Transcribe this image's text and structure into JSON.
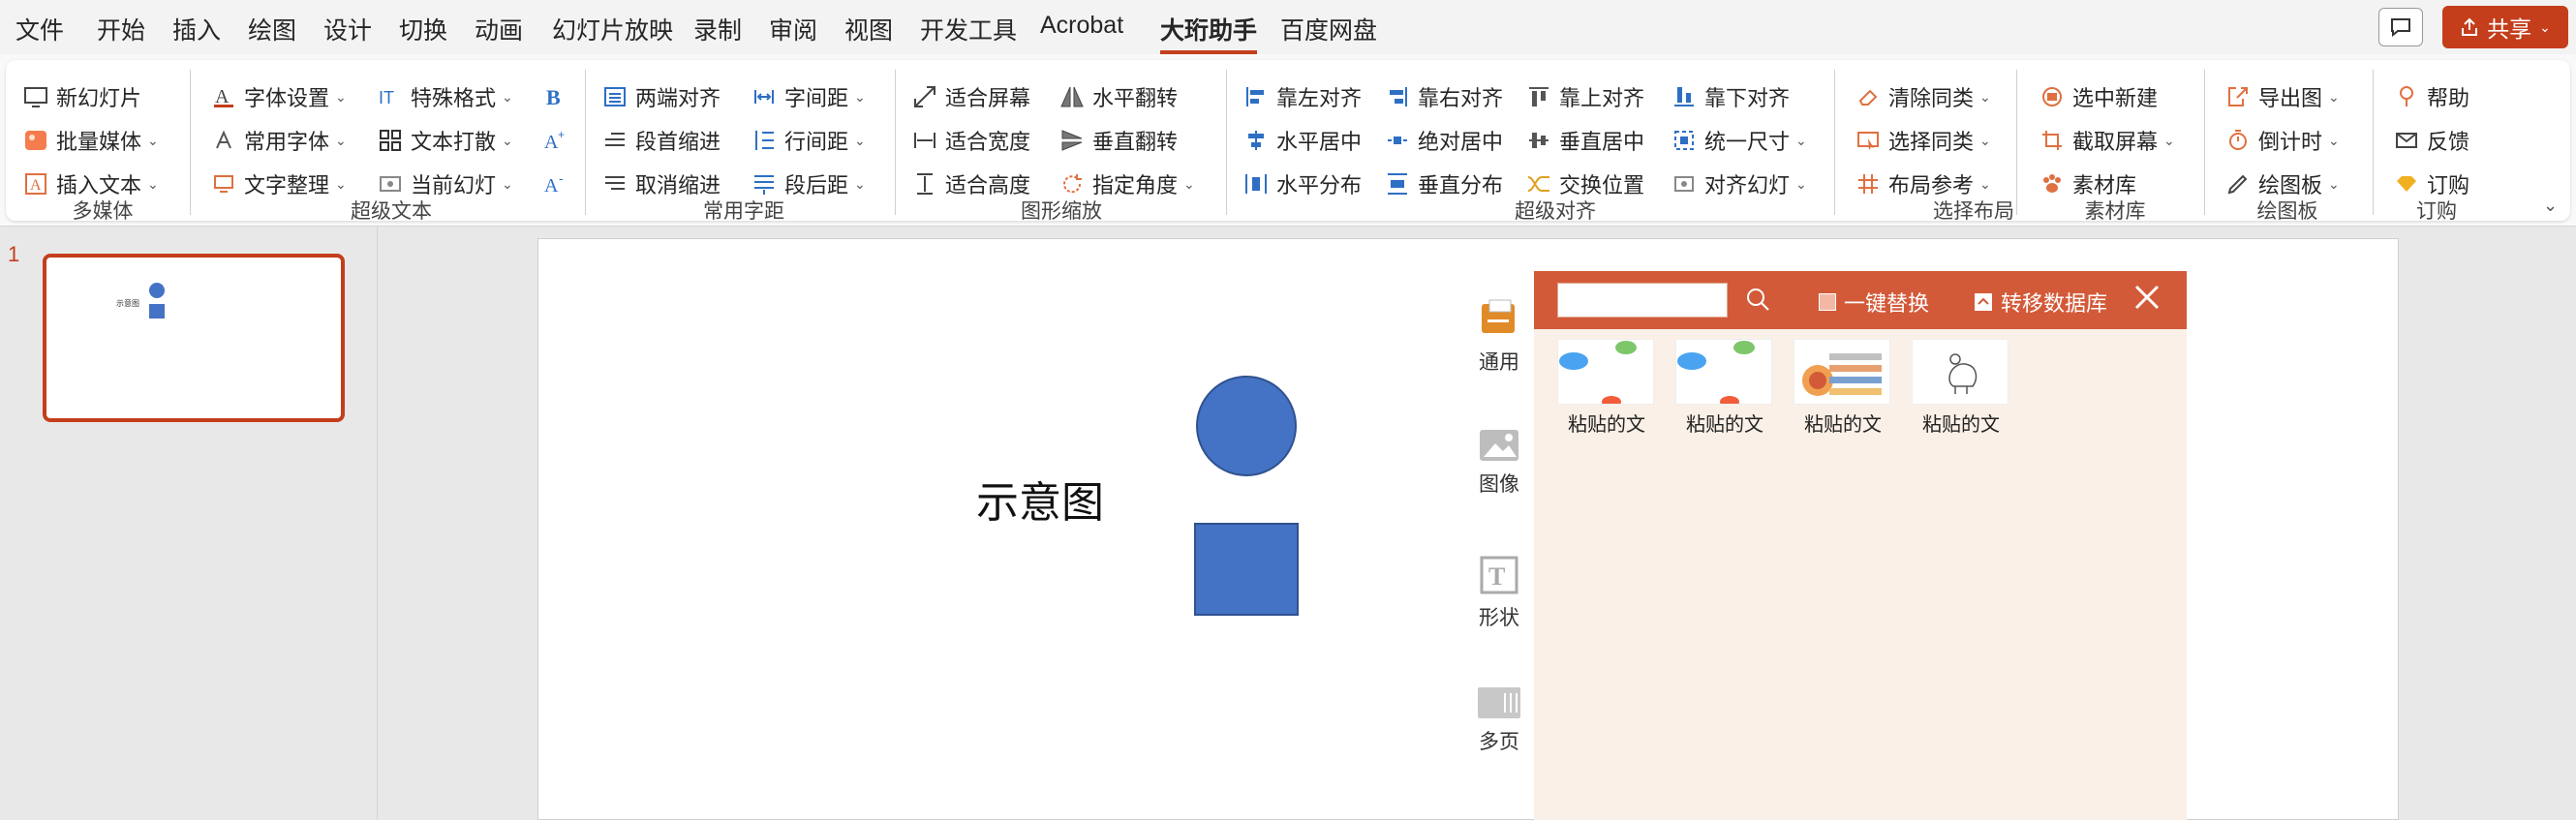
{
  "menu": {
    "tabs": [
      "文件",
      "开始",
      "插入",
      "绘图",
      "设计",
      "切换",
      "动画",
      "幻灯片放映",
      "录制",
      "审阅",
      "视图",
      "开发工具",
      "Acrobat",
      "大珩助手",
      "百度网盘"
    ],
    "active_tab": "大珩助手",
    "share_label": "共享"
  },
  "ribbon": {
    "groups": {
      "multimedia": "多媒体",
      "super_text": "超级文本",
      "spacing": "常用字距",
      "shape_scale": "图形缩放",
      "super_align": "超级对齐",
      "select_layout": "选择布局",
      "material": "素材库",
      "drawing": "绘图板",
      "subscribe": "订购"
    },
    "buttons": {
      "new_slide": "新幻灯片",
      "batch_media": "批量媒体",
      "insert_text": "插入文本",
      "font_settings": "字体设置",
      "common_fonts": "常用字体",
      "text_tidy": "文字整理",
      "special_format": "特殊格式",
      "text_scatter": "文本打散",
      "current_slide": "当前幻灯",
      "justify": "两端对齐",
      "first_indent": "段首缩进",
      "cancel_indent": "取消缩进",
      "char_spacing": "字间距",
      "line_spacing": "行间距",
      "para_after": "段后距",
      "fit_screen": "适合屏幕",
      "fit_width": "适合宽度",
      "fit_height": "适合高度",
      "flip_h": "水平翻转",
      "flip_v": "垂直翻转",
      "set_angle": "指定角度",
      "align_left": "靠左对齐",
      "center_h": "水平居中",
      "dist_h": "水平分布",
      "align_right": "靠右对齐",
      "abs_center": "绝对居中",
      "dist_v": "垂直分布",
      "align_top": "靠上对齐",
      "center_v": "垂直居中",
      "swap_pos": "交换位置",
      "align_bottom": "靠下对齐",
      "uniform_size": "统一尺寸",
      "align_slide": "对齐幻灯",
      "clear_similar": "清除同类",
      "select_similar": "选择同类",
      "layout_ref": "布局参考",
      "select_new": "选中新建",
      "capture_screen": "截取屏幕",
      "material_lib": "素材库",
      "export_image": "导出图",
      "countdown": "倒计时",
      "drawing_board": "绘图板",
      "help": "帮助",
      "feedback": "反馈",
      "subscribe": "订购"
    }
  },
  "thumbnails": {
    "slide_number": "1",
    "thumb_text": "示意图"
  },
  "slide": {
    "text": "示意图"
  },
  "side_tabs": [
    "通用",
    "图像",
    "形状",
    "多页"
  ],
  "panel": {
    "search_placeholder": "",
    "replace_label": "一键替换",
    "migrate_label": "转移数据库",
    "cards": [
      "粘贴的文",
      "粘贴的文",
      "粘贴的文",
      "粘贴的文"
    ]
  },
  "colors": {
    "accent": "#c43e1c",
    "shape_fill": "#4472c4",
    "shape_stroke": "#2f528f",
    "panel_header": "#d35a39",
    "panel_bg": "#faf0e8"
  }
}
